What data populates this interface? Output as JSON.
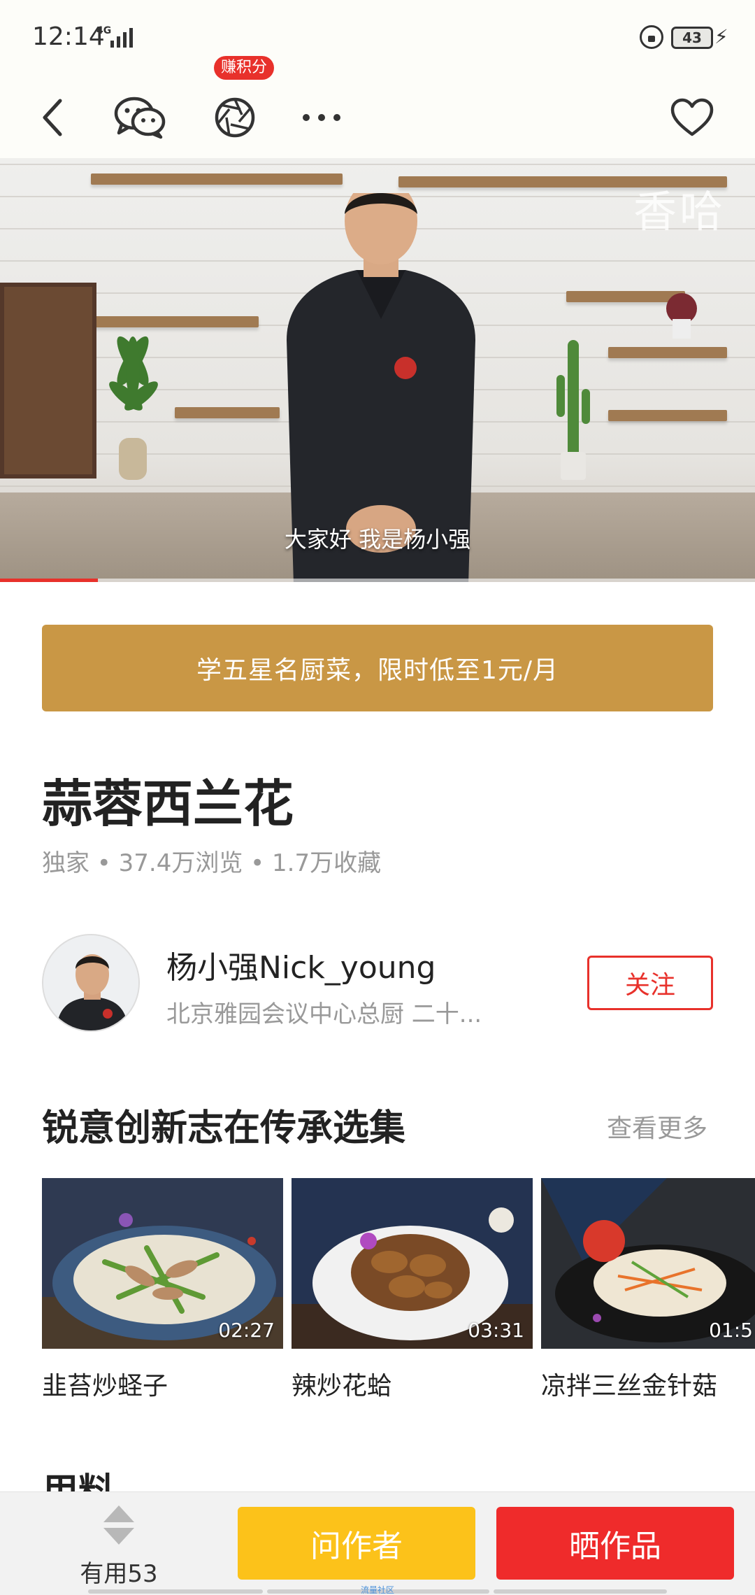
{
  "status_bar": {
    "time": "12:14",
    "network": "4G",
    "battery": "43"
  },
  "toolbar": {
    "back_icon": "chevron-left-icon",
    "wechat_icon": "wechat-icon",
    "camera_icon": "aperture-icon",
    "camera_badge": "赚积分",
    "more_icon": "ellipsis-icon",
    "favorite_icon": "heart-outline-icon"
  },
  "video": {
    "watermark": "香哈",
    "subtitle": "大家好 我是杨小强",
    "progress": 0.13
  },
  "promo": {
    "text": "学五星名厨菜，限时低至1元/月"
  },
  "recipe": {
    "title": "蒜蓉西兰花",
    "meta": "独家 • 37.4万浏览 • 1.7万收藏"
  },
  "author": {
    "name": "杨小强Nick_young",
    "desc": "北京雅园会议中心总厨 二十...",
    "follow_label": "关注"
  },
  "collection": {
    "title": "锐意创新志在传承选集",
    "more_label": "查看更多",
    "items": [
      {
        "name": "韭苔炒蛏子",
        "duration": "02:27"
      },
      {
        "name": "辣炒花蛤",
        "duration": "03:31"
      },
      {
        "name": "凉拌三丝金针菇",
        "duration": "01:5"
      }
    ]
  },
  "next_section": {
    "title": "用料"
  },
  "bottom": {
    "useful_label": "有用53",
    "ask_label": "问作者",
    "show_label": "晒作品",
    "home_note": "流量社区"
  },
  "colors": {
    "accent_red": "#e8312b",
    "promo_gold": "#c99745",
    "ask_yellow": "#fcc21a",
    "show_red": "#ef2b2b"
  }
}
